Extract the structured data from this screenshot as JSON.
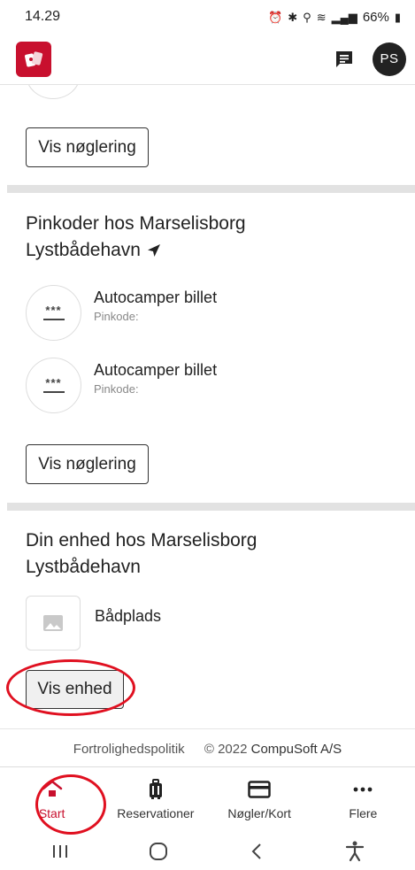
{
  "status_bar": {
    "time": "14.29",
    "battery": "66%"
  },
  "header": {
    "avatar_initials": "PS"
  },
  "colors": {
    "brand": "#c8102e",
    "annotation": "#e01020"
  },
  "sections": {
    "top": {
      "button_label": "Vis nøglering"
    },
    "pincodes": {
      "title_line1": "Pinkoder hos Marselisborg",
      "title_line2": "Lystbådehavn",
      "items": [
        {
          "name": "Autocamper billet",
          "sub": "Pinkode:",
          "code_mask": "***"
        },
        {
          "name": "Autocamper billet",
          "sub": "Pinkode:",
          "code_mask": "***"
        }
      ],
      "button_label": "Vis nøglering"
    },
    "unit": {
      "title_line1": "Din enhed hos Marselisborg",
      "title_line2": "Lystbådehavn",
      "unit_name": "Bådplads",
      "button_label": "Vis enhed"
    }
  },
  "footer": {
    "privacy": "Fortrolighedspolitik",
    "copyright": "© 2022",
    "company": "CompuSoft A/S"
  },
  "bottom_nav": {
    "items": [
      {
        "label": "Start",
        "icon": "home-icon"
      },
      {
        "label": "Reservationer",
        "icon": "luggage-icon"
      },
      {
        "label": "Nøgler/Kort",
        "icon": "card-icon"
      },
      {
        "label": "Flere",
        "icon": "more-icon"
      }
    ]
  }
}
